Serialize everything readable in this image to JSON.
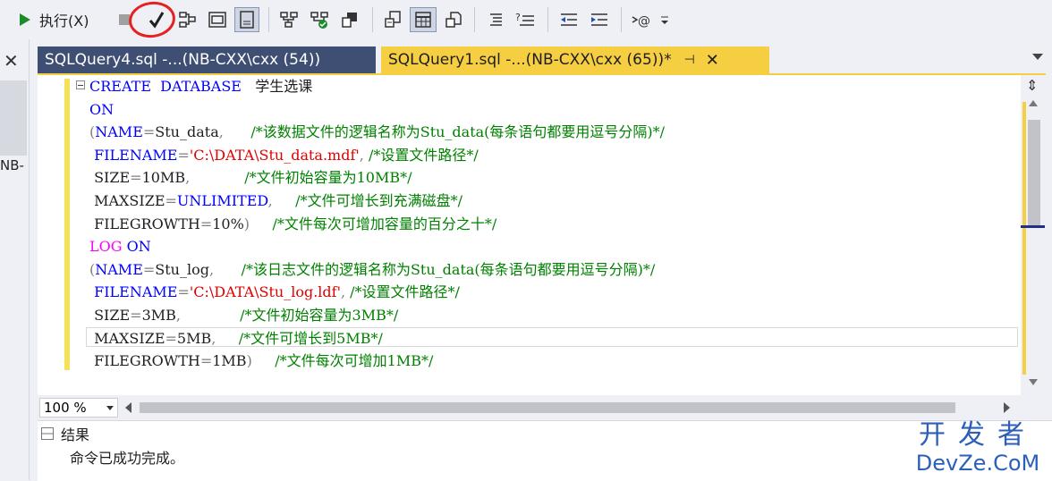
{
  "toolbar": {
    "execute_label": "执行(X)",
    "icons": [
      "play-icon",
      "stop-icon",
      "parse-check-icon",
      "display-plan-icon",
      "query-design-icon",
      "results-to-grid-icon",
      "include-plan-icon",
      "live-stats-icon",
      "client-stats-icon",
      "results-to-text-icon",
      "results-to-grid-icon",
      "results-to-file-icon",
      "comment-icon",
      "uncomment-icon",
      "decrease-indent-icon",
      "increase-indent-icon",
      "specify-values-icon",
      "more-icon"
    ]
  },
  "left_panel": {
    "label": "NB-"
  },
  "tabs": [
    {
      "label": "SQLQuery4.sql -...(NB-CXX\\cxx (54))",
      "active": false
    },
    {
      "label": "SQLQuery1.sql -...(NB-CXX\\cxx (65))*",
      "active": true,
      "pin": "⊣",
      "close": "✕"
    }
  ],
  "code": [
    [
      {
        "t": "CREATE",
        "c": "kw"
      },
      {
        "t": "  ",
        "c": "id"
      },
      {
        "t": "DATABASE",
        "c": "kw"
      },
      {
        "t": "   学生选课",
        "c": "id"
      }
    ],
    [
      {
        "t": "ON",
        "c": "kw"
      }
    ],
    [
      {
        "t": "(",
        "c": "gray"
      },
      {
        "t": "NAME",
        "c": "kw"
      },
      {
        "t": "=",
        "c": "gray"
      },
      {
        "t": "Stu_data",
        "c": "id"
      },
      {
        "t": ",",
        "c": "gray"
      },
      {
        "t": "      /*该数据文件的逻辑名称为Stu_data(每条语句都要用逗号分隔)*/",
        "c": "cm"
      }
    ],
    [
      {
        "t": " FILENAME",
        "c": "kw"
      },
      {
        "t": "=",
        "c": "gray"
      },
      {
        "t": "'C:\\DATA\\Stu_data.mdf'",
        "c": "str"
      },
      {
        "t": ", ",
        "c": "gray"
      },
      {
        "t": "/*设置文件路径*/",
        "c": "cm"
      }
    ],
    [
      {
        "t": " SIZE",
        "c": "id"
      },
      {
        "t": "=",
        "c": "gray"
      },
      {
        "t": "10MB",
        "c": "id"
      },
      {
        "t": ",",
        "c": "gray"
      },
      {
        "t": "            /*文件初始容量为10MB*/",
        "c": "cm"
      }
    ],
    [
      {
        "t": " MAXSIZE",
        "c": "id"
      },
      {
        "t": "=",
        "c": "gray"
      },
      {
        "t": "UNLIMITED",
        "c": "kw"
      },
      {
        "t": ",",
        "c": "gray"
      },
      {
        "t": "     /*文件可增长到充满磁盘*/",
        "c": "cm"
      }
    ],
    [
      {
        "t": " FILEGROWTH",
        "c": "id"
      },
      {
        "t": "=",
        "c": "gray"
      },
      {
        "t": "10%",
        "c": "id"
      },
      {
        "t": ")",
        "c": "gray"
      },
      {
        "t": "     /*文件每次可增加容量的百分之十*/",
        "c": "cm"
      }
    ],
    [
      {
        "t": "LOG ",
        "c": "pink"
      },
      {
        "t": "ON",
        "c": "kw"
      }
    ],
    [
      {
        "t": "(",
        "c": "gray"
      },
      {
        "t": "NAME",
        "c": "kw"
      },
      {
        "t": "=",
        "c": "gray"
      },
      {
        "t": "Stu_log",
        "c": "id"
      },
      {
        "t": ",",
        "c": "gray"
      },
      {
        "t": "      /*该日志文件的逻辑名称为Stu_data(每条语句都要用逗号分隔)*/",
        "c": "cm"
      }
    ],
    [
      {
        "t": " FILENAME",
        "c": "kw"
      },
      {
        "t": "=",
        "c": "gray"
      },
      {
        "t": "'C:\\DATA\\Stu_log.ldf'",
        "c": "str"
      },
      {
        "t": ", ",
        "c": "gray"
      },
      {
        "t": "/*设置文件路径*/",
        "c": "cm"
      }
    ],
    [
      {
        "t": " SIZE",
        "c": "id"
      },
      {
        "t": "=",
        "c": "gray"
      },
      {
        "t": "3MB",
        "c": "id"
      },
      {
        "t": ",",
        "c": "gray"
      },
      {
        "t": "             /*文件初始容量为3MB*/",
        "c": "cm"
      }
    ],
    [
      {
        "t": " MAXSIZE",
        "c": "id"
      },
      {
        "t": "=",
        "c": "gray"
      },
      {
        "t": "5MB",
        "c": "id"
      },
      {
        "t": ",",
        "c": "gray"
      },
      {
        "t": "     /*文件可增长到5MB*/",
        "c": "cm"
      }
    ],
    [
      {
        "t": " FILEGROWTH",
        "c": "id"
      },
      {
        "t": "=",
        "c": "gray"
      },
      {
        "t": "1MB",
        "c": "id"
      },
      {
        "t": ")",
        "c": "gray"
      },
      {
        "t": "     /*文件每次可增加1MB*/",
        "c": "cm"
      }
    ]
  ],
  "status": {
    "zoom": "100 %"
  },
  "results": {
    "tab_label": "结果",
    "message": "命令已成功完成。"
  },
  "watermark": {
    "line1": "开发者",
    "line2": "DevZe.CoM"
  },
  "colors": {
    "tab_active": "#f5ce42",
    "tab_inactive": "#3f4f74",
    "keyword": "#0000ff",
    "string": "#e00000",
    "comment": "#008000",
    "annotation": "#e52121"
  }
}
